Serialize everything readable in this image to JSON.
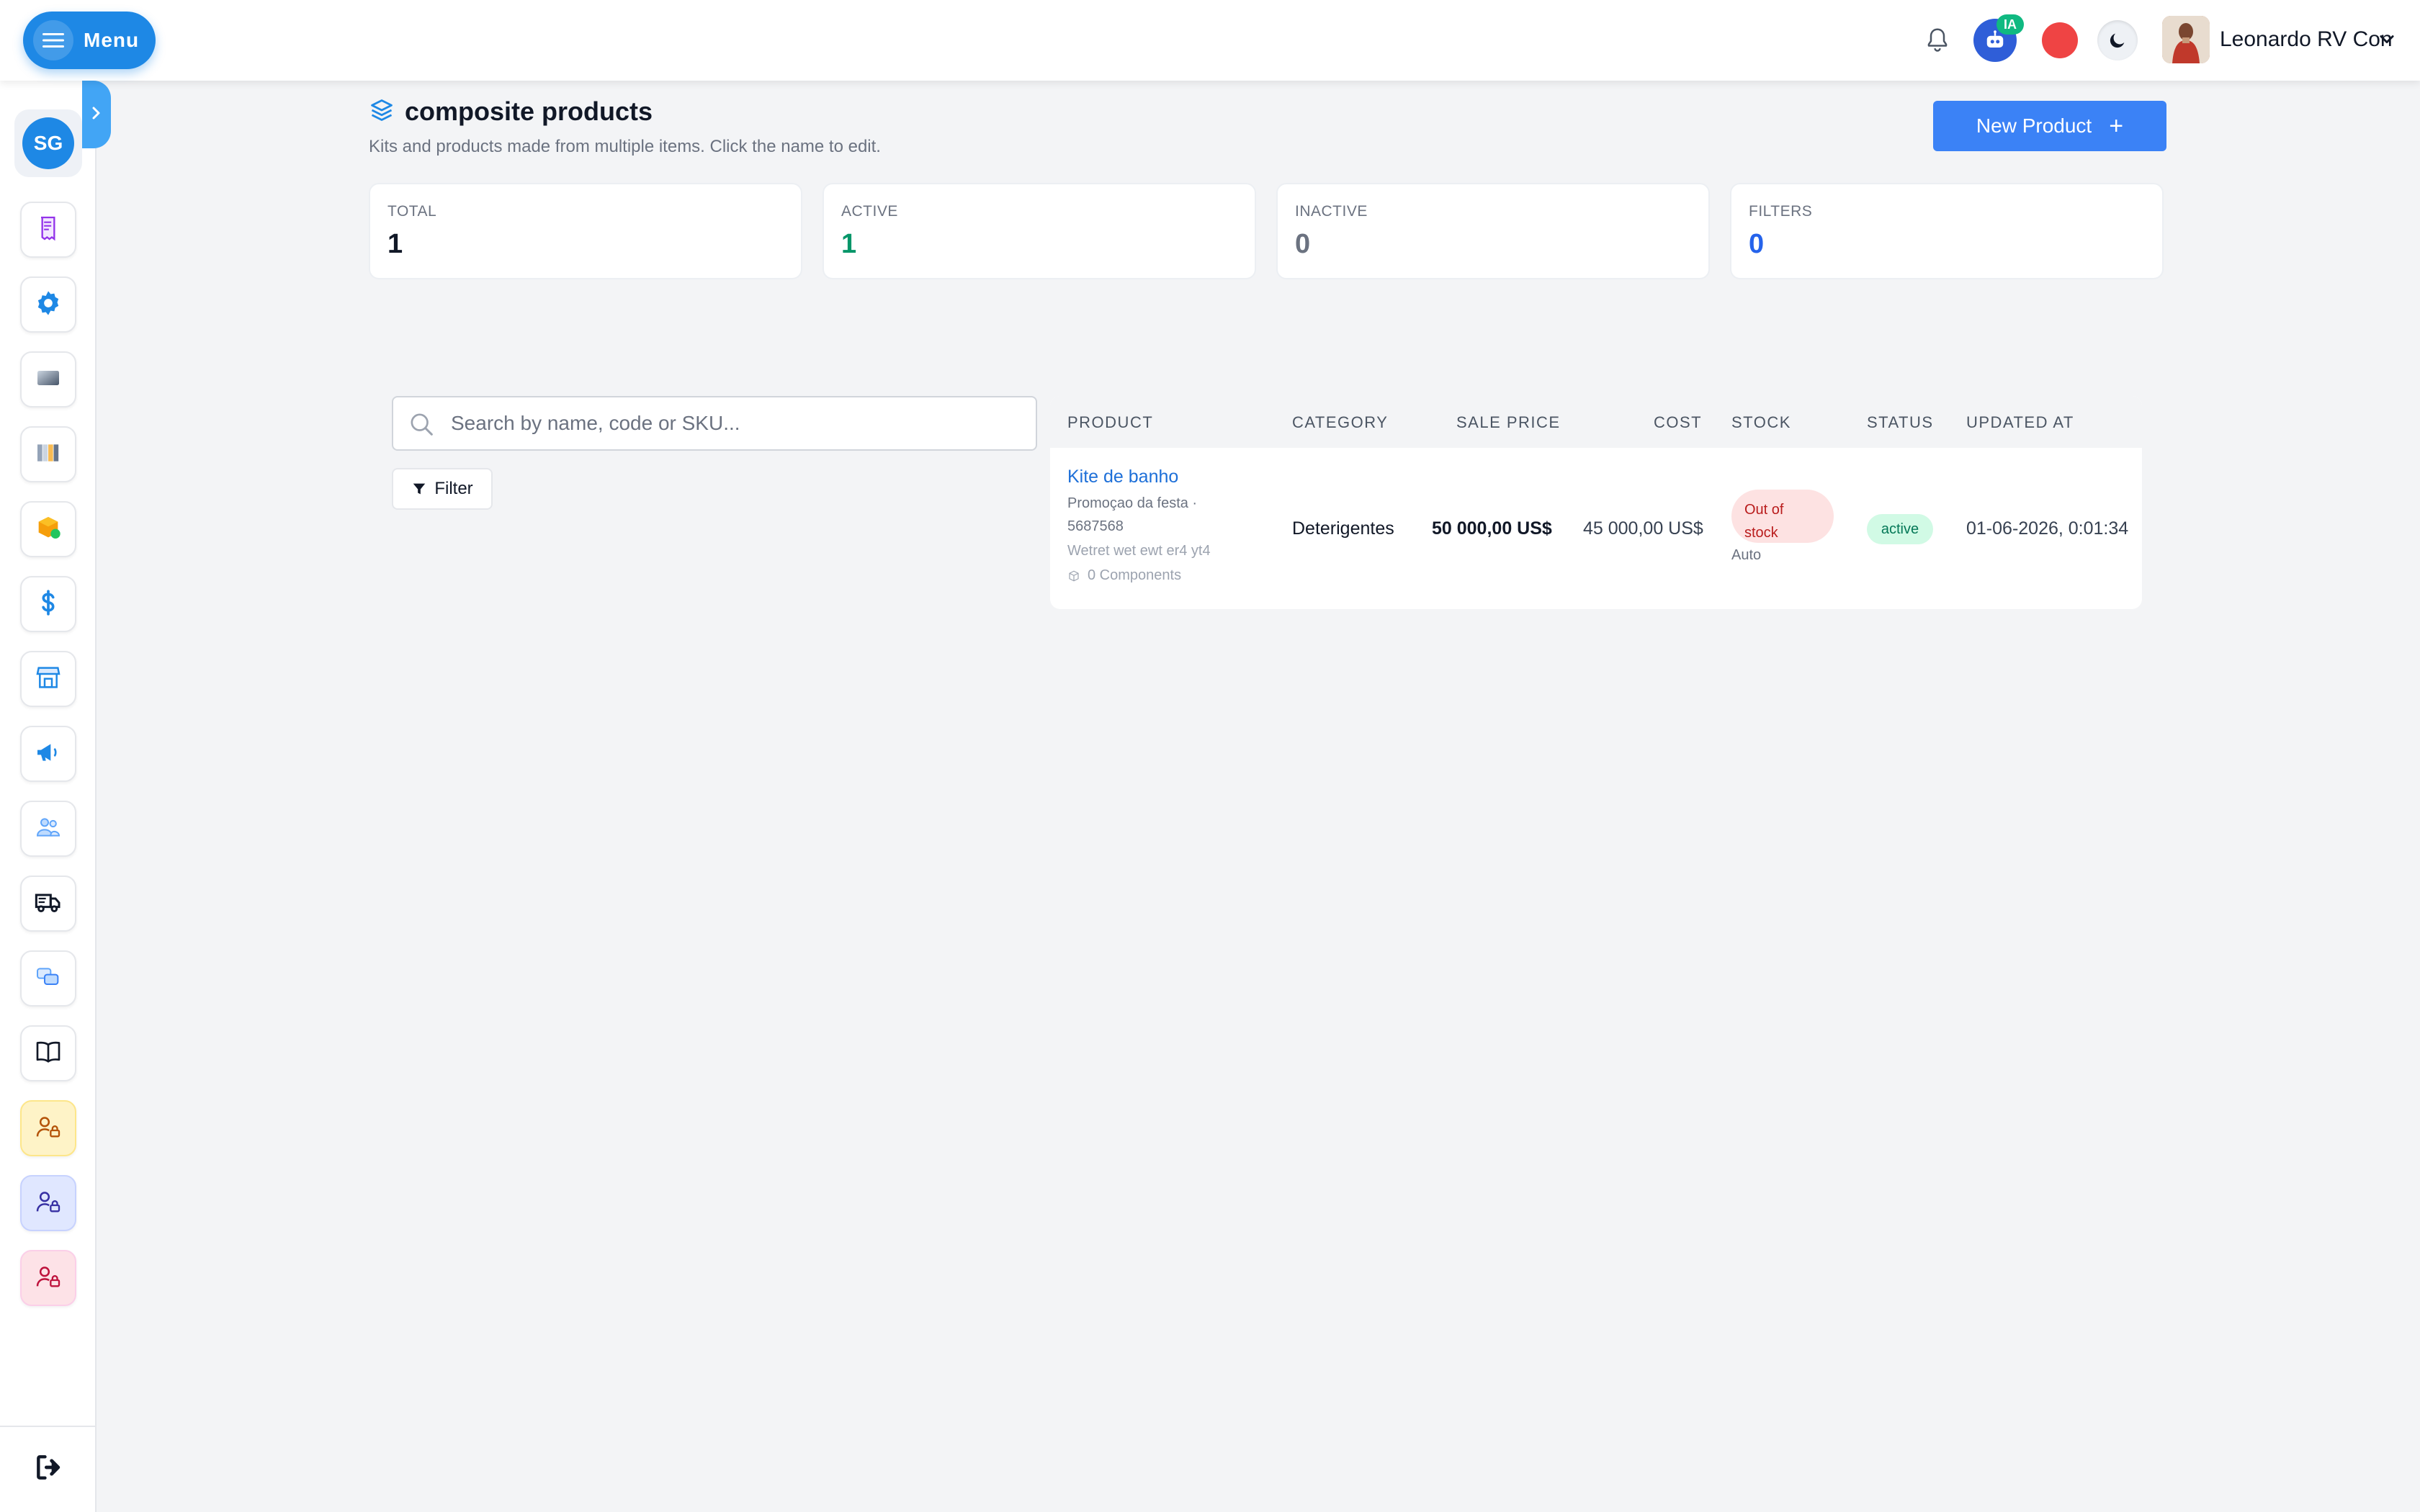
{
  "topbar": {
    "menu_label": "Menu",
    "ai_badge": "IA",
    "user_name": "Leonardo RV Con"
  },
  "sidebar": {
    "workspace_initials": "SG",
    "items": [
      {
        "icon": "receipt-icon"
      },
      {
        "icon": "gear-icon"
      },
      {
        "icon": "gradient-card-icon"
      },
      {
        "icon": "books-icon"
      },
      {
        "icon": "box-icon"
      },
      {
        "icon": "dollar-icon"
      },
      {
        "icon": "store-icon"
      },
      {
        "icon": "megaphone-icon"
      },
      {
        "icon": "people-icon"
      },
      {
        "icon": "truck-icon"
      },
      {
        "icon": "chat-bubbles-icon"
      },
      {
        "icon": "book-open-icon"
      },
      {
        "icon": "user-lock-icon"
      },
      {
        "icon": "user-lock-icon"
      },
      {
        "icon": "user-lock-icon"
      }
    ]
  },
  "header": {
    "title": "composite products",
    "subtitle": "Kits and products made from multiple items. Click the name to edit.",
    "new_button": "New Product"
  },
  "stats": [
    {
      "label": "TOTAL",
      "value": "1",
      "color": "#111827"
    },
    {
      "label": "ACTIVE",
      "value": "1",
      "color": "#059669"
    },
    {
      "label": "INACTIVE",
      "value": "0",
      "color": "#6b7280"
    },
    {
      "label": "FILTERS",
      "value": "0",
      "color": "#2563eb"
    }
  ],
  "search": {
    "placeholder": "Search by name, code or SKU...",
    "filter_label": "Filter"
  },
  "table": {
    "headers": [
      "PRODUCT",
      "CATEGORY",
      "SALE PRICE",
      "COST",
      "STOCK",
      "STATUS",
      "UPDATED AT"
    ],
    "rows": [
      {
        "name": "Kite de banho",
        "sub1": "Promoçao da festa ·",
        "sub2": "5687568",
        "sub3": "Wetret wet ewt er4 yt4",
        "components": "0 Components",
        "category": "Deterigentes",
        "sale_price": "50 000,00 US$",
        "cost": "45 000,00 US$",
        "stock_line1": "Out of",
        "stock_line2": "stock",
        "stock_mode": "Auto",
        "status": "active",
        "updated_at": "01-06-2026, 0:01:34"
      }
    ]
  }
}
